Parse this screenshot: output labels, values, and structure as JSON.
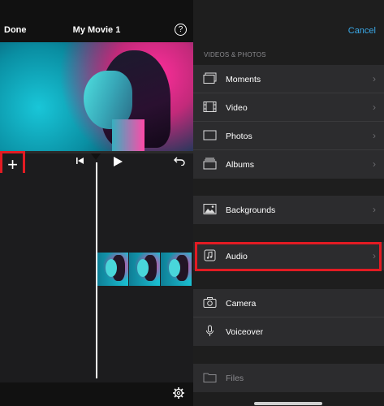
{
  "editor": {
    "done_label": "Done",
    "title": "My Movie 1",
    "help_symbol": "?",
    "add_symbol": "+",
    "icons": [
      "question-icon",
      "skip-back-icon",
      "play-icon",
      "undo-icon",
      "gear-icon"
    ]
  },
  "picker": {
    "cancel_label": "Cancel",
    "section_header": "VIDEOS & PHOTOS",
    "items": [
      {
        "label": "Moments",
        "icon": "moments-icon"
      },
      {
        "label": "Video",
        "icon": "film-icon"
      },
      {
        "label": "Photos",
        "icon": "photo-icon"
      },
      {
        "label": "Albums",
        "icon": "albums-icon"
      },
      {
        "label": "Backgrounds",
        "icon": "landscape-icon"
      },
      {
        "label": "Audio",
        "icon": "music-note-icon"
      },
      {
        "label": "Camera",
        "icon": "camera-icon"
      },
      {
        "label": "Voiceover",
        "icon": "microphone-icon"
      },
      {
        "label": "Files",
        "icon": "folder-icon"
      }
    ],
    "chevron": "›"
  },
  "colors": {
    "highlight": "#e31b23",
    "accent": "#3aa9e8"
  }
}
